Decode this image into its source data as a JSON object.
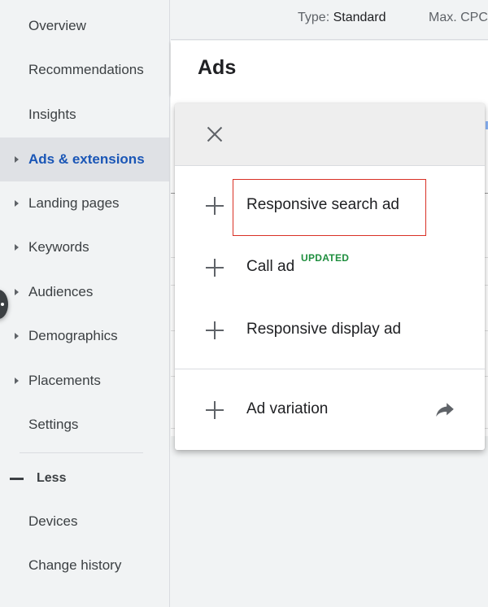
{
  "sidebar": {
    "items": [
      {
        "label": "Overview",
        "has_caret": false,
        "active": false
      },
      {
        "label": "Recommendations",
        "has_caret": false,
        "active": false
      },
      {
        "label": "Insights",
        "has_caret": false,
        "active": false
      },
      {
        "label": "Ads & extensions",
        "has_caret": true,
        "active": true
      },
      {
        "label": "Landing pages",
        "has_caret": true,
        "active": false
      },
      {
        "label": "Keywords",
        "has_caret": true,
        "active": false
      },
      {
        "label": "Audiences",
        "has_caret": true,
        "active": false
      },
      {
        "label": "Demographics",
        "has_caret": true,
        "active": false
      },
      {
        "label": "Placements",
        "has_caret": true,
        "active": false
      },
      {
        "label": "Settings",
        "has_caret": false,
        "active": false
      }
    ],
    "less_label": "Less",
    "extra_items": [
      {
        "label": "Devices"
      },
      {
        "label": "Change history"
      }
    ]
  },
  "topbar": {
    "type_label": "Type:",
    "type_value": "Standard",
    "max_cpc_label": "Max. CPC"
  },
  "ads_header": {
    "title": "Ads"
  },
  "menu": {
    "items": [
      {
        "label": "Responsive search ad",
        "icon": "plus-icon",
        "highlighted": true
      },
      {
        "label": "Call ad",
        "icon": "plus-icon",
        "badge": "UPDATED"
      },
      {
        "label": "Responsive display ad",
        "icon": "plus-icon"
      },
      {
        "label": "Ad variation",
        "icon": "plus-icon",
        "trailing_icon": "share-arrow-icon"
      }
    ]
  },
  "colors": {
    "accent_blue": "#1a56b6",
    "badge_green": "#1e8e3e",
    "highlight_red": "#d93025"
  }
}
